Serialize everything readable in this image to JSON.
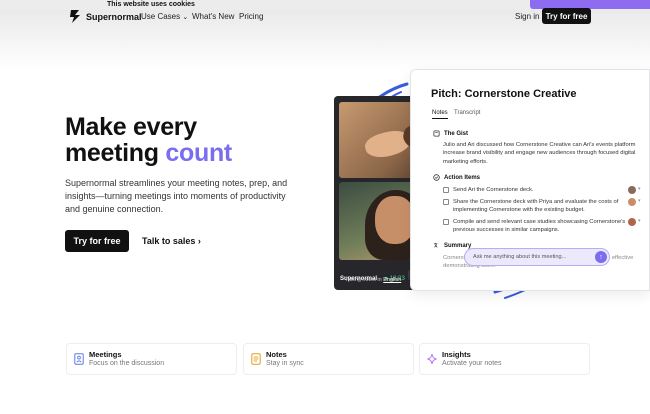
{
  "cookie_banner": {
    "text": "This website uses cookies"
  },
  "brand": {
    "name": "Supernormal",
    "accent_color": "#7b6df0"
  },
  "nav": {
    "items": [
      {
        "label": "Use Cases",
        "dropdown": true
      },
      {
        "label": "What's New"
      },
      {
        "label": "Pricing"
      }
    ],
    "signin_label": "Sign in",
    "cta_label": "Try for free"
  },
  "hero": {
    "title_line1": "Make every",
    "title_line2_plain": "meeting",
    "title_line2_accent": "count",
    "description": "Supernormal streamlines your meeting notes, prep, and insights—turning meetings into moments of productivity and genuine connection.",
    "cta_label": "Try for free",
    "secondary_label": "Talk to sales"
  },
  "demo": {
    "status_brand": "Supernormal",
    "status_time": "18:23",
    "status_text": "Taking notes in",
    "status_language": "English",
    "panel": {
      "title": "Pitch: Cornerstone Creative",
      "tabs": [
        "Notes",
        "Transcript"
      ],
      "gist_heading": "The Gist",
      "gist_text": "Julio and Ari discussed how Cornerstone Creative can Ari's events platform increase brand visibility and engage new audiences through focused digital marketing efforts.",
      "actions_heading": "Action Items",
      "action_items": [
        "Send Ari the Cornerstone deck.",
        "Share the Cornerstone deck with Priya and evaluate the costs of implementing Cornerstone with the existing budget.",
        "Compile and send relevant case studies showcasing Cornerstone's previous successes in similar campaigns."
      ],
      "summary_heading": "Summary",
      "summary_text": "Cornerstone Creative ... provides startups with creative and more effective demonstrating store.",
      "ask_placeholder": "Ask me anything about this meeting..."
    }
  },
  "features": [
    {
      "title": "Meetings",
      "subtitle": "Focus on the discussion",
      "icon": "meetings-icon",
      "color": "#5b7be0"
    },
    {
      "title": "Notes",
      "subtitle": "Stay in sync",
      "icon": "notes-icon",
      "color": "#e0a020"
    },
    {
      "title": "Insights",
      "subtitle": "Activate your notes",
      "icon": "sparkle-icon",
      "color": "#a46de8"
    }
  ]
}
